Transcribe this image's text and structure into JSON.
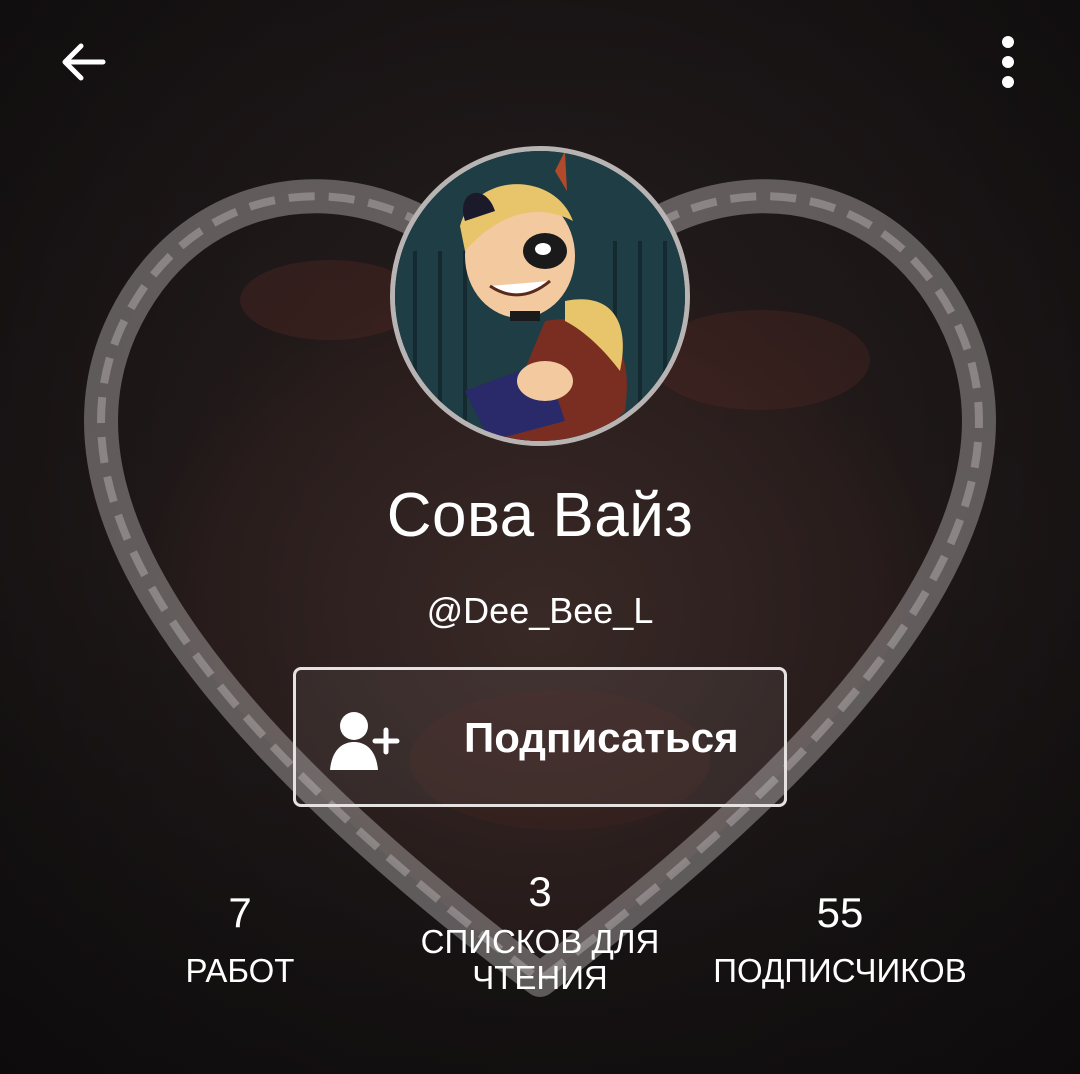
{
  "profile": {
    "display_name": "Сова Вайз",
    "username": "@Dee_Bee_L"
  },
  "follow_button": {
    "label": "Подписаться",
    "icon": "add-user-icon"
  },
  "stats": {
    "works": {
      "value": "7",
      "label": "РАБОТ"
    },
    "reading_lists": {
      "value": "3",
      "label": "СПИСКОВ ДЛЯ ЧТЕНИЯ"
    },
    "followers": {
      "value": "55",
      "label": "ПОДПИСЧИКОВ"
    }
  },
  "icons": {
    "back": "arrow-left-icon",
    "menu": "more-vertical-icon"
  },
  "colors": {
    "background": "#151314",
    "text": "#ffffff",
    "accent_border": "#e6e2e2"
  }
}
